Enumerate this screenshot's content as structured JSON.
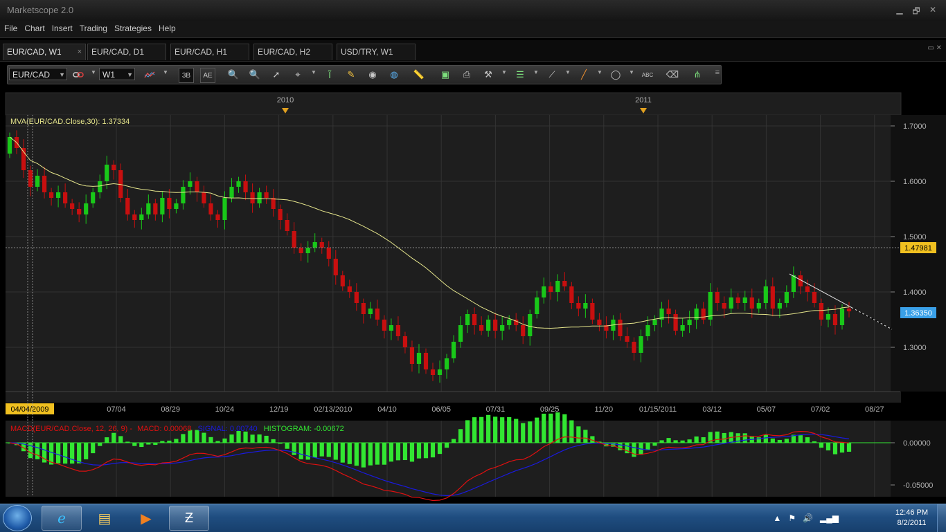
{
  "window": {
    "title": "Marketscope 2.0",
    "buttons": [
      "▁",
      "🗗",
      "✕"
    ]
  },
  "menu": [
    "File",
    "Chart",
    "Insert",
    "Trading",
    "Strategies",
    "Help"
  ],
  "tabs": [
    {
      "label": "EUR/CAD, W1",
      "active": true,
      "close": "×"
    },
    {
      "label": "EUR/CAD, D1"
    },
    {
      "label": "EUR/CAD, H1"
    },
    {
      "label": "EUR/CAD, H2"
    },
    {
      "label": "USD/TRY, W1"
    }
  ],
  "toolbar": {
    "symbol": "EUR/CAD",
    "period": "W1",
    "icons": [
      "chart-type-icon",
      "bar-style-icon",
      "candle-style-icon",
      "zoom-in-icon",
      "zoom-out-icon",
      "cursor-icon",
      "crosshair-icon",
      "indicator-icon",
      "edit-icon",
      "eye-icon",
      "globe-icon",
      "ruler-icon",
      "image-icon",
      "print-icon",
      "tools-icon",
      "channel-icon",
      "fan-icon",
      "pencil-icon",
      "ellipse-icon",
      "text-icon",
      "eraser-icon",
      "objects-icon"
    ],
    "letters": {
      "bars": "3B",
      "candles": "AE",
      "text_tool": "ABC"
    }
  },
  "chart": {
    "years": [
      "2010",
      "2011"
    ],
    "indicator_label": "MVA(EUR/CAD.Close,30): 1.37334",
    "price_ticks": [
      "1.7000",
      "1.6000",
      "1.5000",
      "1.4000",
      "1.3000"
    ],
    "crosshair_price": "1.47981",
    "current_price": "1.36350",
    "date_labels": [
      "04/04/2009",
      "07/04",
      "08/29",
      "10/24",
      "12/19",
      "02/13/2010",
      "04/10",
      "06/05",
      "07/31",
      "09/25",
      "11/20",
      "01/15/2011",
      "03/12",
      "05/07",
      "07/02",
      "08/27"
    ],
    "macd_label": {
      "name": "MACD(EUR/CAD.Close, 12, 26, 9) -",
      "macd": "MACD: 0.00068",
      "signal": "SIGNAL: 0.00740",
      "histogram": "HISTOGRAM: -0.00672"
    },
    "macd_ticks": [
      "0.00000",
      "-0.05000"
    ],
    "colors": {
      "up": "#19c819",
      "down": "#c80f0f",
      "mva": "#e6e68c",
      "macd": "#e01010",
      "signal": "#1a1ae0",
      "hist": "#32e632",
      "grid": "#333333",
      "bg": "#1e1e1e",
      "current_price": "#3aa0e8",
      "crosshair_price": "#f0c020"
    }
  },
  "chart_data": {
    "type": "candlestick",
    "symbol": "EUR/CAD",
    "timeframe": "W1",
    "ylim": [
      1.22,
      1.72
    ],
    "close": [
      1.68,
      1.66,
      1.62,
      1.59,
      1.61,
      1.58,
      1.57,
      1.58,
      1.56,
      1.55,
      1.54,
      1.56,
      1.58,
      1.6,
      1.63,
      1.62,
      1.57,
      1.54,
      1.53,
      1.54,
      1.56,
      1.54,
      1.57,
      1.55,
      1.56,
      1.59,
      1.6,
      1.58,
      1.56,
      1.54,
      1.53,
      1.57,
      1.59,
      1.6,
      1.58,
      1.56,
      1.58,
      1.57,
      1.55,
      1.53,
      1.51,
      1.48,
      1.47,
      1.48,
      1.49,
      1.48,
      1.46,
      1.43,
      1.41,
      1.4,
      1.38,
      1.36,
      1.37,
      1.35,
      1.33,
      1.34,
      1.32,
      1.3,
      1.27,
      1.29,
      1.26,
      1.25,
      1.26,
      1.28,
      1.31,
      1.34,
      1.36,
      1.34,
      1.33,
      1.35,
      1.33,
      1.34,
      1.35,
      1.34,
      1.32,
      1.36,
      1.39,
      1.41,
      1.4,
      1.42,
      1.41,
      1.38,
      1.37,
      1.38,
      1.35,
      1.34,
      1.33,
      1.35,
      1.32,
      1.31,
      1.29,
      1.32,
      1.34,
      1.35,
      1.37,
      1.36,
      1.33,
      1.34,
      1.35,
      1.37,
      1.35,
      1.4,
      1.38,
      1.37,
      1.39,
      1.38,
      1.39,
      1.37,
      1.38,
      1.41,
      1.37,
      1.38,
      1.4,
      1.43,
      1.41,
      1.4,
      1.38,
      1.35,
      1.36,
      1.34,
      1.37,
      1.365
    ],
    "mva_period": 30,
    "mva_value": 1.37334,
    "macd": {
      "fast": 12,
      "slow": 26,
      "signal": 9,
      "macd": 0.00068,
      "signal_value": 0.0074,
      "histogram": -0.00672
    }
  },
  "taskbar": {
    "time": "12:46 PM",
    "date": "8/2/2011"
  }
}
